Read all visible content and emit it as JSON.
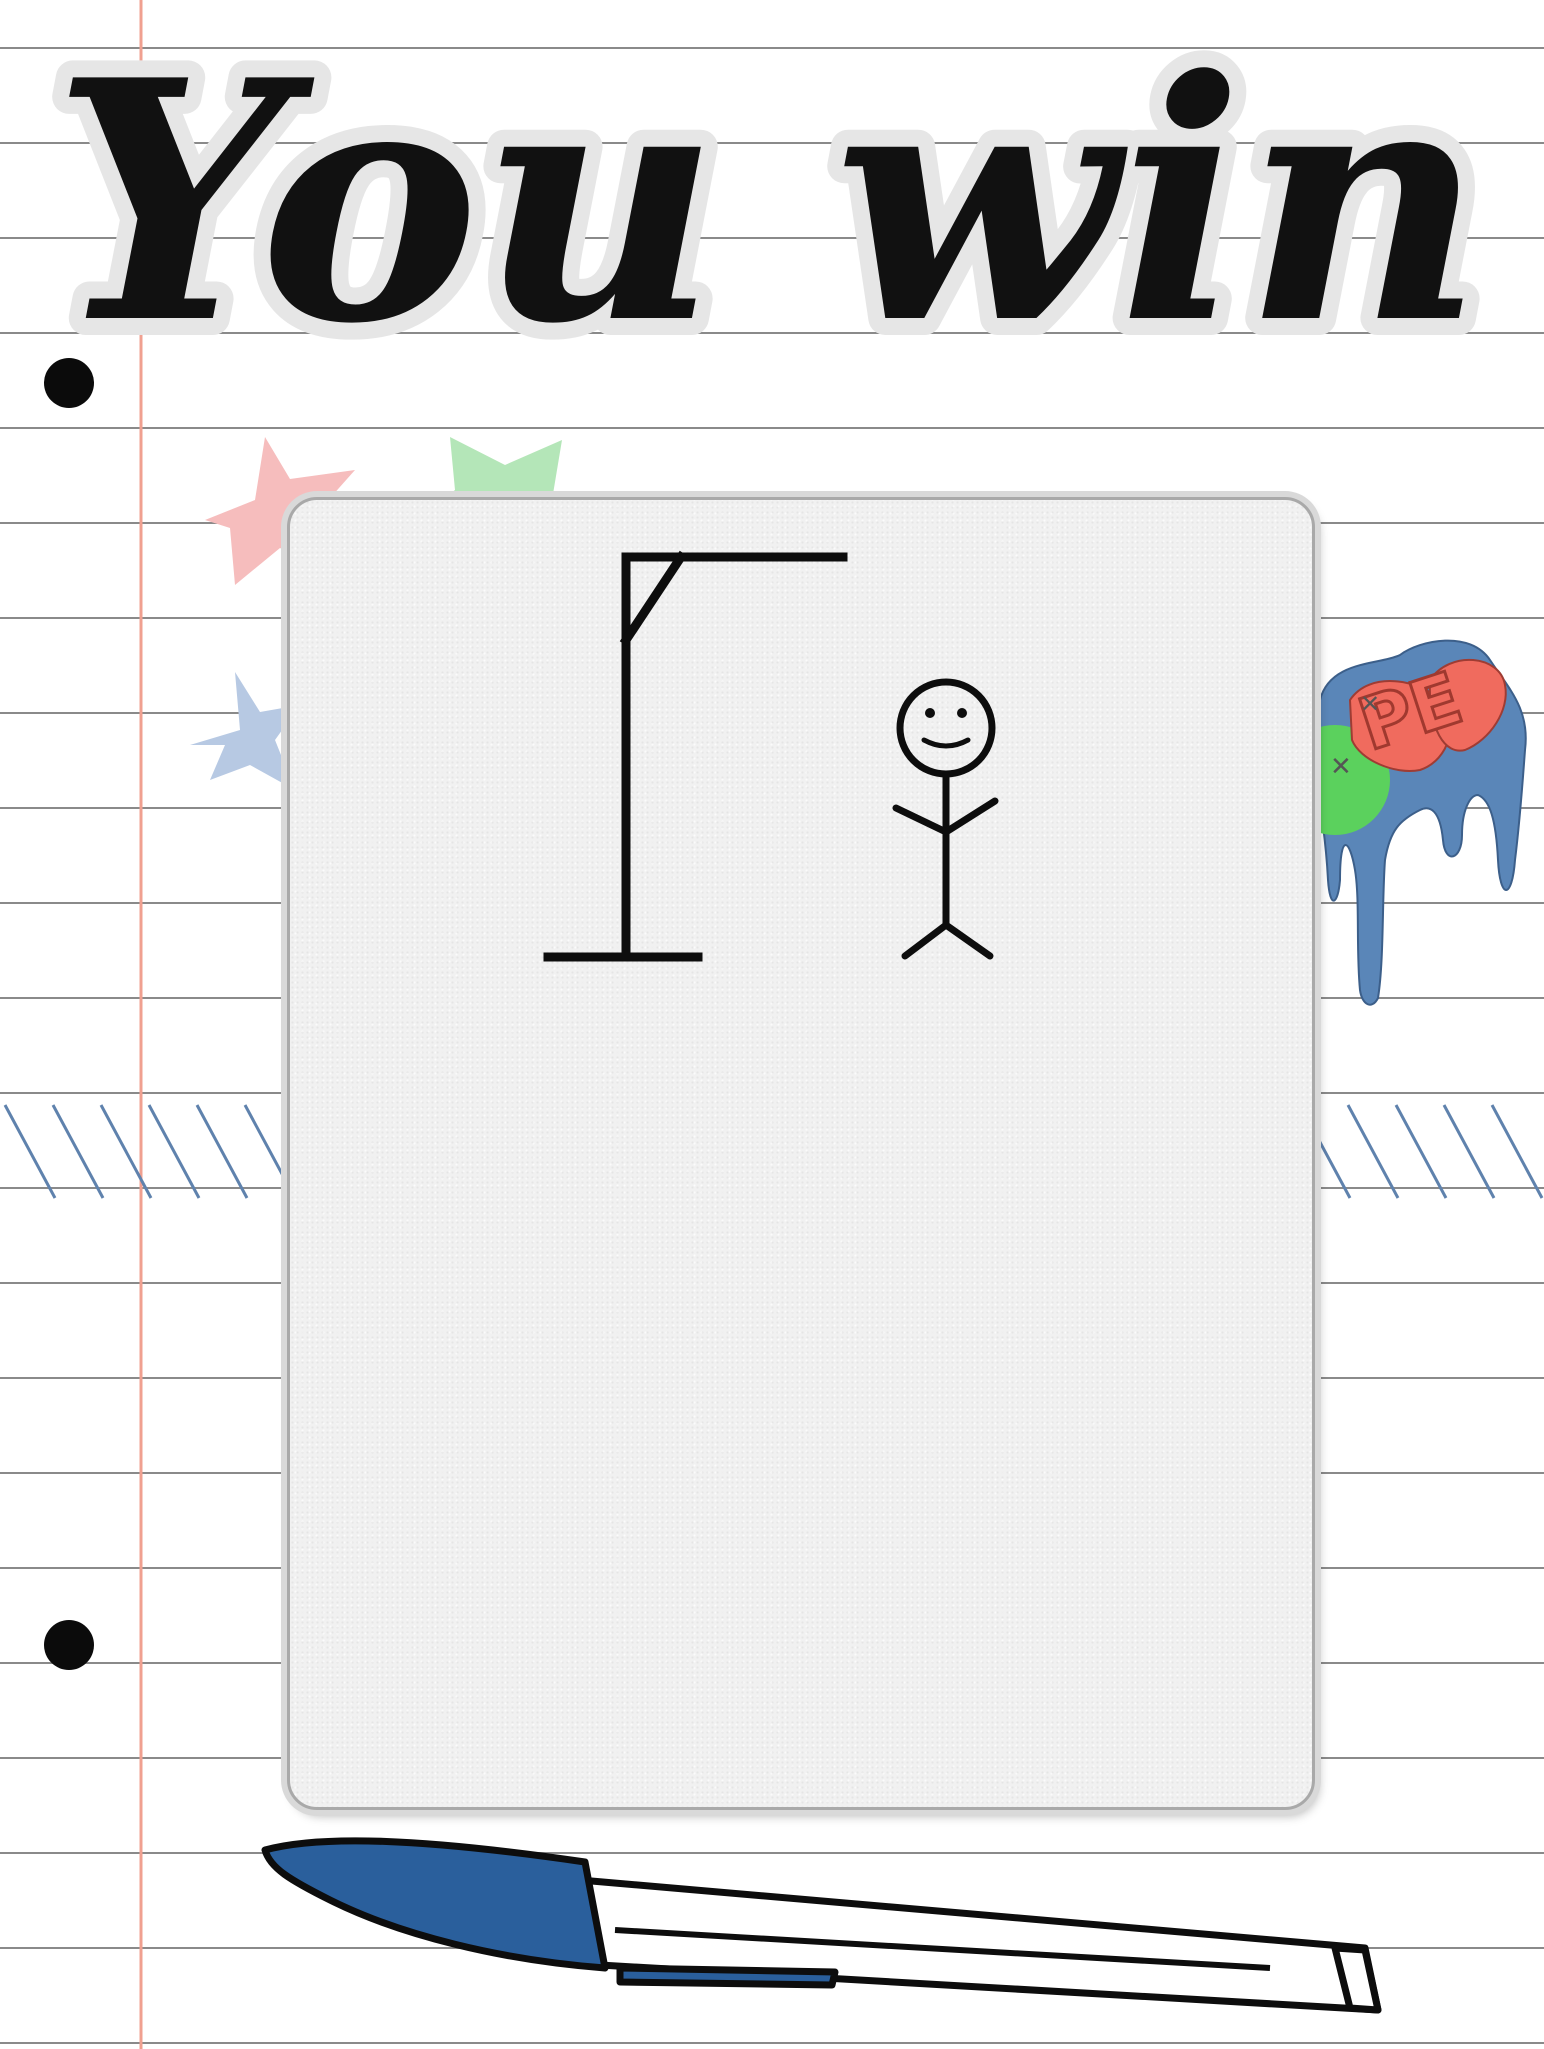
{
  "game": {
    "result_title": "You win",
    "sticker_text": "PE"
  },
  "colors": {
    "paper_rule": "#8a8a8a",
    "margin_line": "#f0a090",
    "hole": "#0b0b0b",
    "star_pink": "#f6bdbd",
    "star_green": "#b4e6b8",
    "star_blue": "#b7c9e3",
    "hatch": "#5f82ad",
    "sticker_blue": "#5a86b8",
    "sticker_red": "#f06b5e",
    "sticker_green": "#5bd15d",
    "pen_blue": "#2a5f9c",
    "card_fill": "#f1f1f1",
    "ink": "#111111"
  },
  "icons": {
    "stick_figure": "smiling-stick-figure-icon",
    "gallows": "gallows-icon",
    "pen": "ballpoint-pen-icon",
    "sticker": "dripping-sticker-icon"
  }
}
